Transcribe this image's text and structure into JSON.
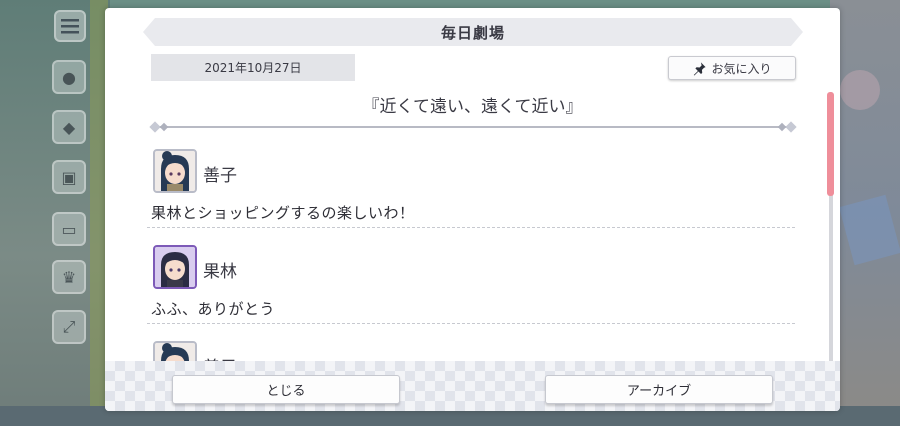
{
  "dialog": {
    "title": "毎日劇場",
    "date": "2021年10月27日",
    "favorite_label": "お気に入り",
    "story_title": "『近くて遠い、遠くて近い』",
    "messages": [
      {
        "speaker": "善子",
        "line": "果林とショッピングするの楽しいわ！"
      },
      {
        "speaker": "果林",
        "line": "ふふ、ありがとう"
      },
      {
        "speaker": "善子",
        "line": ""
      }
    ],
    "close_label": "とじる",
    "archive_label": "アーカイブ"
  },
  "colors": {
    "accent_scroll": "#ef8e9a",
    "avatar_purple_border": "#7d5ab8"
  },
  "icons": {
    "favorite": "pin-icon",
    "left_menu": "hamburger-icon"
  }
}
